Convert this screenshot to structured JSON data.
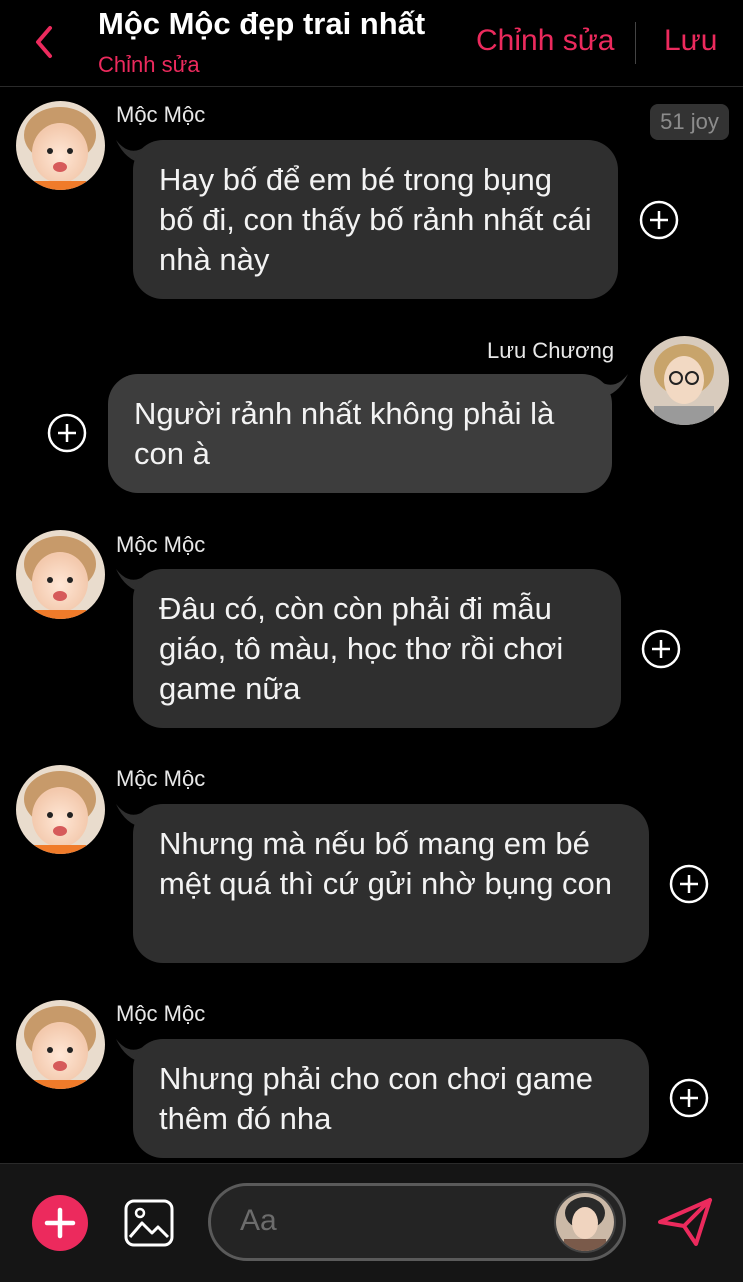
{
  "header": {
    "title": "Mộc Mộc đẹp trai nhất",
    "subtitle": "Chỉnh sửa",
    "edit_label": "Chỉnh sửa",
    "save_label": "Lưu",
    "back_icon": "chevron-left-icon"
  },
  "badge": {
    "text": "51 joy"
  },
  "messages": [
    {
      "sender": "Mộc Mộc",
      "side": "left",
      "text": "Hay bố để em bé trong bụng bố đi, con thấy bố rảnh nhất cái nhà này"
    },
    {
      "sender": "Lưu Chương",
      "side": "right",
      "text": "Người rảnh nhất không phải là con à"
    },
    {
      "sender": "Mộc Mộc",
      "side": "left",
      "text": "Đâu có, còn còn phải đi mẫu giáo, tô màu, học thơ rồi chơi game nữa"
    },
    {
      "sender": "Mộc Mộc",
      "side": "left",
      "text": "Nhưng mà nếu bố mang em bé mệt quá thì cứ gửi nhờ bụng con"
    },
    {
      "sender": "Mộc Mộc",
      "side": "left",
      "text": "Nhưng phải cho con chơi game thêm đó nha"
    }
  ],
  "composer": {
    "placeholder": "Aa",
    "add_icon": "plus-icon",
    "image_icon": "image-icon",
    "send_icon": "send-icon"
  },
  "colors": {
    "accent": "#ec2a5d",
    "background": "#000000",
    "bubble": "#2f2f2f"
  }
}
